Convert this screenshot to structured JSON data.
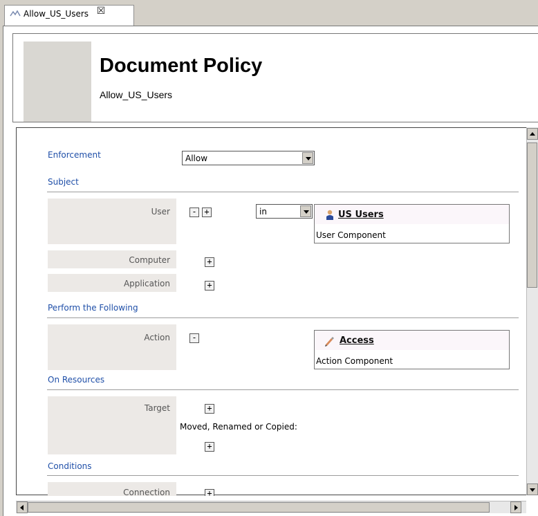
{
  "tab": {
    "label": "Allow_US_Users",
    "close_glyph": "☒"
  },
  "header": {
    "title": "Document Policy",
    "subtitle": "Allow_US_Users"
  },
  "enforcement": {
    "label": "Enforcement",
    "value": "Allow"
  },
  "subject": {
    "section_label": "Subject",
    "user": {
      "label": "User",
      "operator": "in",
      "component": {
        "name": "US Users",
        "type": "User Component",
        "icon": "user-icon"
      }
    },
    "computer_label": "Computer",
    "application_label": "Application"
  },
  "perform": {
    "section_label": "Perform the Following",
    "action": {
      "label": "Action",
      "component": {
        "name": "Access",
        "type": "Action Component",
        "icon": "pen-icon"
      }
    }
  },
  "resources": {
    "section_label": "On Resources",
    "target_label": "Target",
    "moved_label": "Moved, Renamed or Copied:"
  },
  "conditions": {
    "section_label": "Conditions",
    "connection_label": "Connection"
  },
  "buttons": {
    "minus": "-",
    "plus": "+"
  },
  "colors": {
    "section_text": "#1f4fa8",
    "row_bg": "#ece9e6",
    "chrome": "#d4d0c8"
  }
}
